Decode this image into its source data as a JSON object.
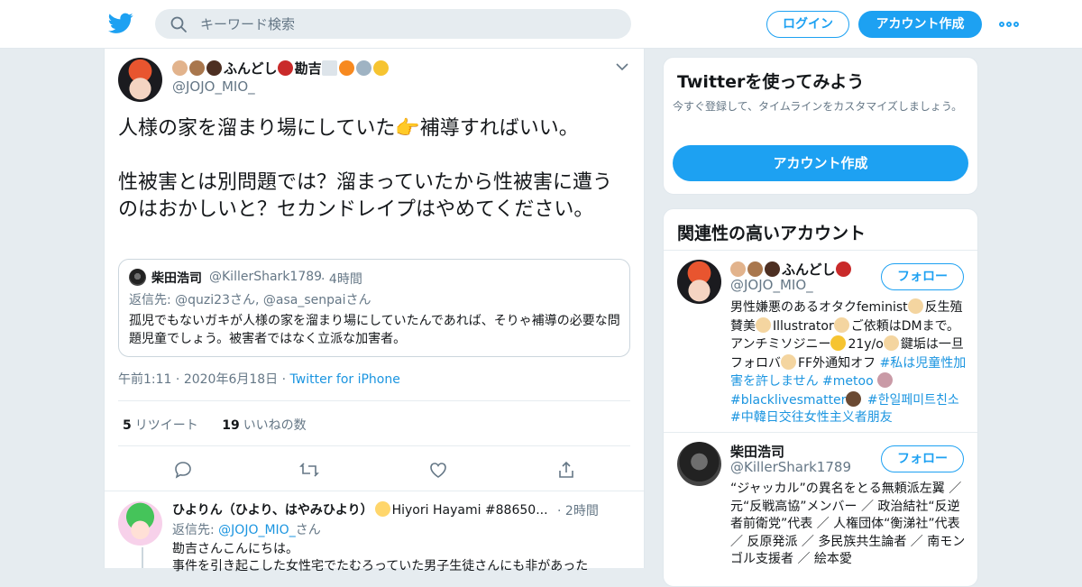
{
  "header": {
    "search_placeholder": "キーワード検索",
    "login": "ログイン",
    "signup": "アカウント作成",
    "accent": "#1da1f2"
  },
  "tweet": {
    "author": "ふんどし",
    "author_suffix": "勘吉",
    "handle": "@JOJO_MIO_",
    "text": "人様の家を溜まり場にしていた👉補導すればいい。\n\n性被害とは別問題では？溜まっていたから性被害に遭うのはおかしいと？セカンドレイプはやめてください。",
    "time": "午前1:11",
    "date": "2020年6月18日",
    "source": "Twitter for iPhone",
    "retweets_count": "5",
    "retweets_label": "リツイート",
    "likes_count": "19",
    "likes_label": "いいねの数"
  },
  "quote": {
    "name": "柴田浩司",
    "handle": "@KillerShark1789",
    "time": "4時間",
    "reply_to": "返信先: @quzi23さん, @asa_senpaiさん",
    "text": "孤児でもないガキが人様の家を溜まり場にしていたんであれば、そりゃ補導の必要な問題児童でしょう。被害者ではなく立派な加害者。"
  },
  "reply": {
    "name": "ひよりん（ひより、はやみひより）",
    "name_suffix": "Hiyori Hayami #88650...",
    "time": "2時間",
    "reply_prefix": "返信先: ",
    "reply_link": "@JOJO_MIO_",
    "reply_suffix": "さん",
    "text1": "勘吉さんこんにちは。",
    "text2": "事件を引き起こした女性宅でたむろっていた男子生徒さんにも非があった"
  },
  "sidebar": {
    "try_title": "Twitterを使ってみよう",
    "try_desc": "今すぐ登録して、タイムラインをカスタマイズしましょう。",
    "try_cta": "アカウント作成",
    "related_title": "関連性の高いアカウント",
    "follow_label": "フォロー",
    "accounts": [
      {
        "name": "ふんどし",
        "handle": "@JOJO_MIO_",
        "bio_a": "男性嫌悪のあるオタクfeminist",
        "bio_b": "反生殖賛美",
        "bio_c": "Illustrator",
        "bio_d": "ご依頼はDMまで。アンチミソジニー",
        "bio_e": "21y/o",
        "bio_f": "鍵垢は一旦フォロバ",
        "bio_g": "FF外通知オフ",
        "tag1": "#私は児童性加害を許しません",
        "tag2": "#metoo",
        "tag3": "#blacklivesmatter",
        "tag4": "#한일페미트친소",
        "tag5": "#中韓日交往女性主义者朋友"
      },
      {
        "name": "柴田浩司",
        "handle": "@KillerShark1789",
        "bio": "“ジャッカル”の異名をとる無頼派左翼 ／ 元“反戦高協”メンバー ／ 政治結社“反逆者前衛党”代表 ／ 人権団体“衡涕社”代表 ／ 反原発派 ／ 多民族共生論者 ／ 南モンゴル支援者 ／ 絵本愛"
      }
    ]
  }
}
